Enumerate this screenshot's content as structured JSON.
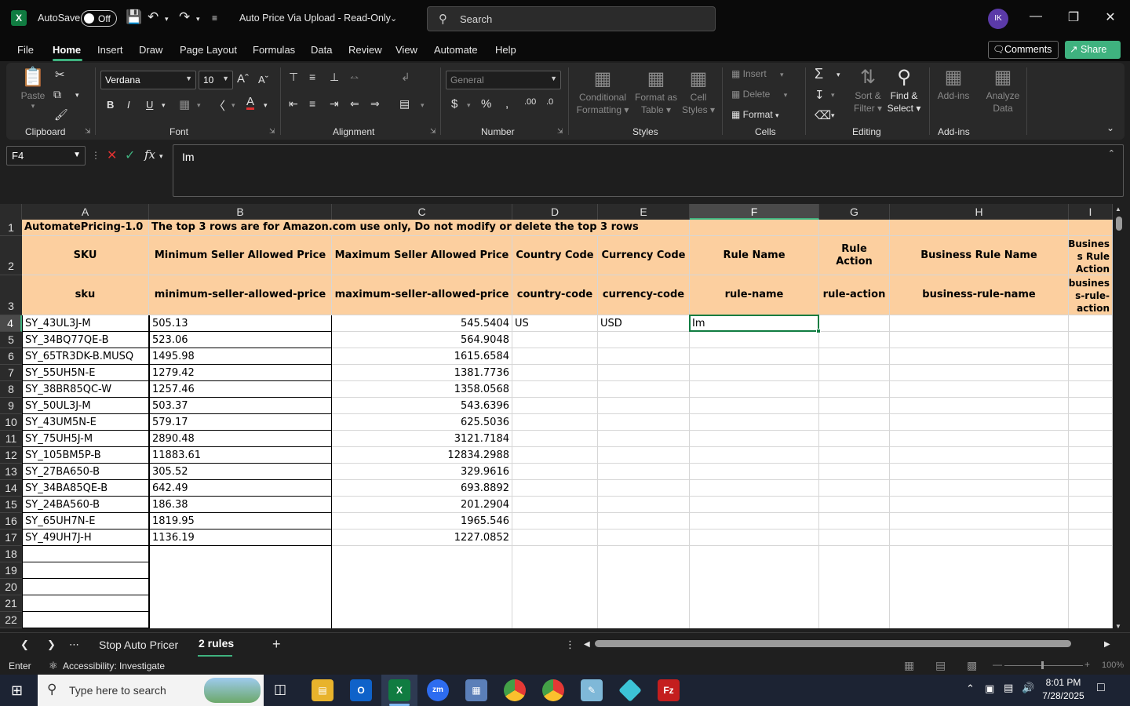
{
  "titlebar": {
    "autosave_label": "AutoSave",
    "autosave_state": "Off",
    "doc_title": "Auto Price Via Upload  -  Read-Only",
    "search_placeholder": "Search",
    "user_initials": "IK"
  },
  "menu": {
    "items": [
      "File",
      "Home",
      "Insert",
      "Draw",
      "Page Layout",
      "Formulas",
      "Data",
      "Review",
      "View",
      "Automate",
      "Help"
    ],
    "active": "Home",
    "comments_label": "Comments",
    "share_label": "Share"
  },
  "ribbon": {
    "clipboard": {
      "paste": "Paste",
      "label": "Clipboard"
    },
    "font": {
      "name": "Verdana",
      "size": "10",
      "label": "Font"
    },
    "alignment": {
      "label": "Alignment"
    },
    "number": {
      "format": "General",
      "label": "Number"
    },
    "styles": {
      "conditional": "Conditional",
      "formatting": "Formatting",
      "format_as": "Format as",
      "table": "Table",
      "cell": "Cell",
      "styles": "Styles",
      "label": "Styles"
    },
    "cells": {
      "insert": "Insert",
      "delete": "Delete",
      "format": "Format",
      "label": "Cells"
    },
    "editing": {
      "sort": "Sort &",
      "filter": "Filter",
      "find": "Find &",
      "select": "Select",
      "label": "Editing"
    },
    "addins": {
      "addins": "Add-ins",
      "analyze": "Analyze",
      "data": "Data",
      "label": "Add-ins"
    }
  },
  "formula_bar": {
    "name_box": "F4",
    "fx": "fx",
    "content": "Im"
  },
  "grid": {
    "columns": [
      "A",
      "B",
      "C",
      "D",
      "E",
      "F",
      "G",
      "H",
      "I"
    ],
    "rows": [
      "1",
      "2",
      "3",
      "4",
      "5",
      "6",
      "7",
      "8",
      "9",
      "10",
      "11",
      "12",
      "13",
      "14",
      "15",
      "16",
      "17",
      "18",
      "19",
      "20",
      "21",
      "22"
    ],
    "row1": {
      "a": "AutomatePricing-1.0",
      "b": "The top 3 rows are for Amazon.com use only, Do not modify or delete the top 3 rows"
    },
    "row2": [
      "SKU",
      "Minimum Seller Allowed Price",
      "Maximum Seller Allowed Price",
      "Country Code",
      "Currency Code",
      "Rule Name",
      "Rule Action",
      "Business Rule Name",
      "Busines s Rule Action"
    ],
    "row3": [
      "sku",
      "minimum-seller-allowed-price",
      "maximum-seller-allowed-price",
      "country-code",
      "currency-code",
      "rule-name",
      "rule-action",
      "business-rule-name",
      "busines s-rule-action"
    ],
    "data": [
      [
        "SY_43UL3J-M",
        "505.13",
        "545.5404",
        "US",
        "USD",
        "Im"
      ],
      [
        "SY_34BQ77QE-B",
        "523.06",
        "564.9048",
        "",
        "",
        ""
      ],
      [
        "SY_65TR3DK-B.MUSQ",
        "1495.98",
        "1615.6584",
        "",
        "",
        ""
      ],
      [
        "SY_55UH5N-E",
        "1279.42",
        "1381.7736",
        "",
        "",
        ""
      ],
      [
        "SY_38BR85QC-W",
        "1257.46",
        "1358.0568",
        "",
        "",
        ""
      ],
      [
        "SY_50UL3J-M",
        "503.37",
        "543.6396",
        "",
        "",
        ""
      ],
      [
        "SY_43UM5N-E",
        "579.17",
        "625.5036",
        "",
        "",
        ""
      ],
      [
        "SY_75UH5J-M",
        "2890.48",
        "3121.7184",
        "",
        "",
        ""
      ],
      [
        "SY_105BM5P-B",
        "11883.61",
        "12834.2988",
        "",
        "",
        ""
      ],
      [
        "SY_27BA650-B",
        "305.52",
        "329.9616",
        "",
        "",
        ""
      ],
      [
        "SY_34BA85QE-B",
        "642.49",
        "693.8892",
        "",
        "",
        ""
      ],
      [
        "SY_24BA560-B",
        "186.38",
        "201.2904",
        "",
        "",
        ""
      ],
      [
        "SY_65UH7N-E",
        "1819.95",
        "1965.546",
        "",
        "",
        ""
      ],
      [
        "SY_49UH7J-H",
        "1136.19",
        "1227.0852",
        "",
        "",
        ""
      ]
    ],
    "active_cell": "F4"
  },
  "sheets": {
    "tabs": [
      "Stop Auto Pricer",
      "2 rules"
    ],
    "active": "2 rules"
  },
  "status": {
    "mode": "Enter",
    "accessibility": "Accessibility: Investigate",
    "zoom": "100%"
  },
  "taskbar": {
    "search_placeholder": "Type here to search",
    "time": "8:01 PM",
    "date": "7/28/2025"
  },
  "colors": {
    "header_fill": "#fccf9f",
    "accent": "#3fb27f",
    "excel_green": "#107c41"
  }
}
